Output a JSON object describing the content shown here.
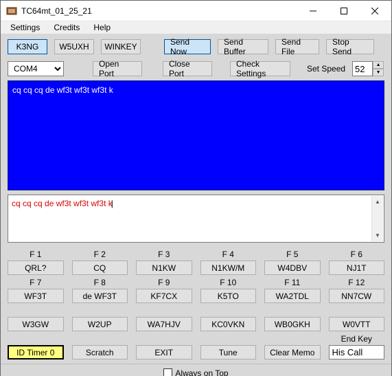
{
  "window": {
    "title": "TC64mt_01_25_21"
  },
  "menu": {
    "settings": "Settings",
    "credits": "Credits",
    "help": "Help"
  },
  "row1": {
    "k3ng": "K3NG",
    "w5uxh": "W5UXH",
    "winkey": "WINKEY",
    "sendnow": "Send Now",
    "sendbuffer": "Send Buffer",
    "sendfile": "Send File",
    "stopsend": "Stop Send"
  },
  "row2": {
    "port": "COM4",
    "openport": "Open Port",
    "closeport": "Close Port",
    "checksettings": "Check Settings",
    "setspeed_label": "Set Speed",
    "speed": "52"
  },
  "tx_log": "cq cq cq de wf3t wf3t wf3t k",
  "tx_input": "cq cq cq de wf3t wf3t wf3t k",
  "fkeys": {
    "labels": [
      "F 1",
      "F 2",
      "F 3",
      "F 4",
      "F 5",
      "F 6",
      "F 7",
      "F 8",
      "F 9",
      "F 10",
      "F 11",
      "F 12"
    ],
    "row1": [
      "QRL?",
      "CQ",
      "N1KW",
      "N1KW/M",
      "W4DBV",
      "NJ1T"
    ],
    "row2": [
      "WF3T",
      "de WF3T",
      "KF7CX",
      "K5TO",
      "WA2TDL",
      "NN7CW"
    ],
    "row3": [
      "W3GW",
      "W2UP",
      "WA7HJV",
      "KC0VKN",
      "WB0GKH",
      "W0VTT"
    ]
  },
  "bottomrow": {
    "idtimer": "ID Timer 0",
    "scratch": "Scratch",
    "exit": "EXIT",
    "tune": "Tune",
    "clearmemo": "Clear Memo",
    "endkey_label": "End Key",
    "endkey_value": "His Call"
  },
  "footer": {
    "alwaysontop": "Always on Top"
  }
}
